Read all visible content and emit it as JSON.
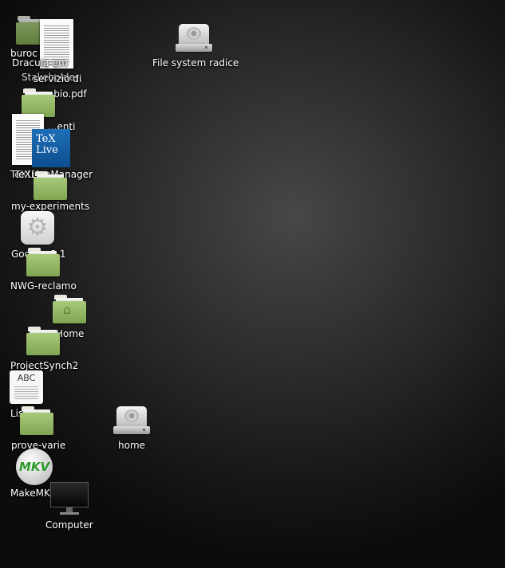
{
  "desktop": {
    "icons": {
      "burocrazia": {
        "label": "buroc",
        "icon": "dark-folder-icon"
      },
      "dracula": {
        "label": "Dracula-em",
        "icon": "folder-icon"
      },
      "servizio": {
        "label": "servizio di scambio.pdf",
        "icon": "pdf-document-icon"
      },
      "stakeholder": {
        "label": "Stakeholder",
        "icon": "text-overlap"
      },
      "file_system_root": {
        "label": "File system radice",
        "icon": "hard-drive-icon"
      },
      "documenti": {
        "label": "...enti",
        "icon": "folder-icon"
      },
      "texlive_doc": {
        "label": "TeXLive",
        "icon": "document-icon"
      },
      "texlive": {
        "label": "TeX Live",
        "icon": "texlive-icon"
      },
      "texlive_manager": {
        "label": "TeXLiveManager",
        "icon": "texlive-icon"
      },
      "my_experiments": {
        "label": "my-experiments",
        "icon": "folder-icon"
      },
      "godot": {
        "label": "Godot_v2.1",
        "icon": "gears-icon"
      },
      "nwg_reclamo": {
        "label": "NWG-reclamo",
        "icon": "folder-icon"
      },
      "home_folder": {
        "label": "Home",
        "icon": "home-folder-icon"
      },
      "project_synch2": {
        "label": "ProjectSynch2",
        "icon": "folder-icon"
      },
      "list_txt": {
        "label": "List.txt",
        "icon": "text-file-icon",
        "badge": "ABC"
      },
      "prove_varie": {
        "label": "prove-varie",
        "icon": "folder-icon"
      },
      "home_drive": {
        "label": "home",
        "icon": "hard-drive-icon"
      },
      "makemkv": {
        "label": "MakeMKV",
        "icon": "makemkv-icon",
        "badge": "MKV"
      },
      "computer": {
        "label": "Computer",
        "icon": "monitor-icon"
      }
    }
  }
}
